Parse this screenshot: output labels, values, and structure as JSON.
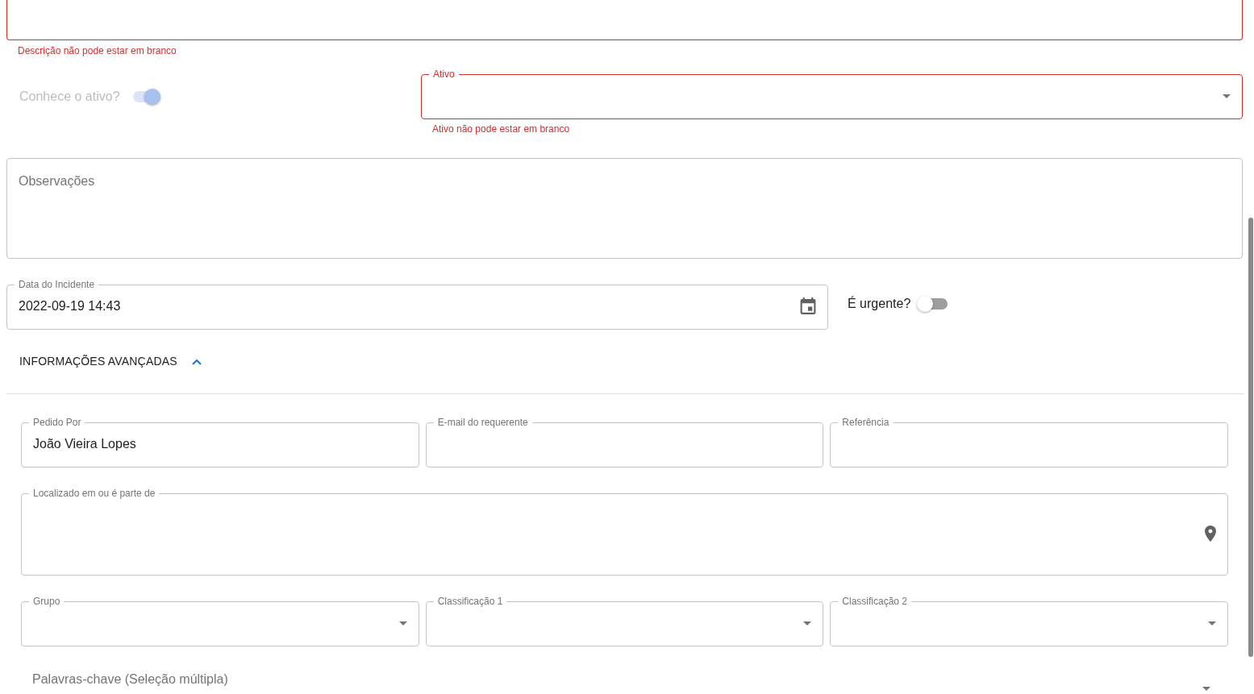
{
  "description_field": {
    "error": true,
    "helper_text": "Descrição não pode estar em branco"
  },
  "known_asset_switch": {
    "label": "Conhece o ativo?",
    "on": true,
    "disabled": true
  },
  "asset_select": {
    "label": "Ativo",
    "error": true,
    "helper_text": "Ativo não pode estar em branco"
  },
  "notes_field": {
    "placeholder": "Observações"
  },
  "incident_date_field": {
    "label": "Data do Incidente",
    "value": "2022-09-19 14:43"
  },
  "urgent_switch": {
    "label": "É urgente?",
    "on": false,
    "disabled": false
  },
  "advanced_section": {
    "title": "INFORMAÇÕES AVANÇADAS",
    "expanded": true,
    "fields": [
      {
        "label": "Pedido Por",
        "value": "João Vieira Lopes"
      },
      {
        "label": "E-mail do requerente"
      },
      {
        "label": "Referência"
      }
    ],
    "location_field": {
      "label": "Localizado em ou é parte de"
    },
    "selects": [
      {
        "label": "Grupo"
      },
      {
        "label": "Classificação 1"
      },
      {
        "label": "Classificação 2"
      }
    ],
    "keywords_select": {
      "placeholder": "Palavras-chave (Seleção múltipla)"
    }
  }
}
